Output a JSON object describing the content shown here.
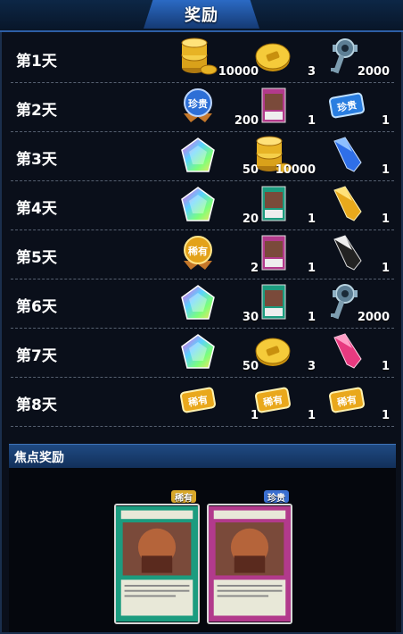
{
  "header": {
    "title": "奖励"
  },
  "rows": [
    {
      "day": "第1天",
      "rewards": [
        {
          "icon": "gold-coin-stack-icon",
          "qty": "10000"
        },
        {
          "icon": "coin-icon",
          "qty": "3"
        },
        {
          "icon": "key-icon",
          "qty": "2000"
        }
      ]
    },
    {
      "day": "第2天",
      "rewards": [
        {
          "icon": "rarity-medal-icon",
          "qty": "200"
        },
        {
          "icon": "trap-card-icon",
          "qty": "1"
        },
        {
          "icon": "rarity-ticket-icon",
          "qty": "1"
        }
      ]
    },
    {
      "day": "第3天",
      "rewards": [
        {
          "icon": "rainbow-gem-icon",
          "qty": "50"
        },
        {
          "icon": "gold-coin-stack-icon",
          "qty": "10000"
        },
        {
          "icon": "blue-crystal-icon",
          "qty": "1"
        }
      ]
    },
    {
      "day": "第4天",
      "rewards": [
        {
          "icon": "rainbow-gem-icon",
          "qty": "20"
        },
        {
          "icon": "spell-card-icon",
          "qty": "1"
        },
        {
          "icon": "gold-crystal-icon",
          "qty": "1"
        }
      ]
    },
    {
      "day": "第5天",
      "rewards": [
        {
          "icon": "gold-medal-icon",
          "qty": "2"
        },
        {
          "icon": "trap-card-icon",
          "qty": "1"
        },
        {
          "icon": "black-crystal-icon",
          "qty": "1"
        }
      ]
    },
    {
      "day": "第6天",
      "rewards": [
        {
          "icon": "rainbow-gem-icon",
          "qty": "30"
        },
        {
          "icon": "spell-card-icon",
          "qty": "1"
        },
        {
          "icon": "key-icon",
          "qty": "2000"
        }
      ]
    },
    {
      "day": "第7天",
      "rewards": [
        {
          "icon": "rainbow-gem-icon",
          "qty": "50"
        },
        {
          "icon": "coin-icon",
          "qty": "3"
        },
        {
          "icon": "pink-crystal-icon",
          "qty": "1"
        }
      ]
    },
    {
      "day": "第8天",
      "rewards": [
        {
          "icon": "rare-ticket-icon",
          "qty": "1",
          "label": "稀有"
        },
        {
          "icon": "rare-ticket-icon",
          "qty": "1",
          "label": "稀有"
        },
        {
          "icon": "rare-ticket-icon",
          "qty": "1",
          "label": "稀有"
        }
      ]
    }
  ],
  "focus": {
    "title": "焦点奖励",
    "cards": [
      {
        "badge": "稀有",
        "badge_color": "#d9a82a",
        "card_color": "#1c9c7f",
        "icon": "spell-card-icon"
      },
      {
        "badge": "珍贵",
        "badge_color": "#3b6fd0",
        "card_color": "#b23a8c",
        "icon": "trap-card-icon"
      }
    ]
  },
  "icon_labels": {
    "rarity_sr": "珍贵",
    "rarity_r": "稀有"
  }
}
